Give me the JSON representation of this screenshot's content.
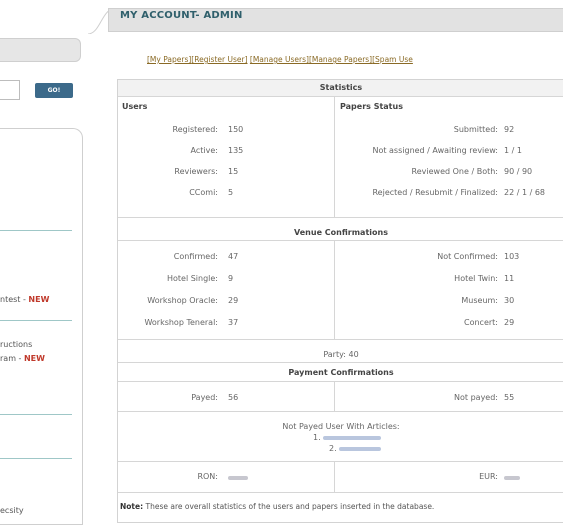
{
  "sidebar": {
    "go_label": "GO!",
    "links": [
      {
        "text": "ntest - ",
        "badge": "NEW"
      },
      {
        "text": "ructions",
        "badge": ""
      },
      {
        "text": "ram - ",
        "badge": "NEW"
      },
      {
        "text": "ecsity",
        "badge": ""
      }
    ]
  },
  "header": {
    "title": "MY ACCOUNT- ADMIN"
  },
  "nav": [
    "[My Papers]",
    "[Register User]",
    "[Manage Users]",
    "[Manage Papers]",
    "[Spam Use"
  ],
  "stats": {
    "title": "Statistics",
    "users": {
      "heading": "Users",
      "rows": [
        {
          "label": "Registered:",
          "value": "150"
        },
        {
          "label": "Active:",
          "value": "135"
        },
        {
          "label": "Reviewers:",
          "value": "15"
        },
        {
          "label": "CComi:",
          "value": "5"
        }
      ]
    },
    "papers": {
      "heading": "Papers Status",
      "rows": [
        {
          "label": "Submitted:",
          "value": "92"
        },
        {
          "label": "Not assigned / Awaiting review:",
          "value": "1 / 1"
        },
        {
          "label": "Reviewed One / Both:",
          "value": "90 / 90"
        },
        {
          "label": "Rejected / Resubmit / Finalized:",
          "value": "22 / 1 / 68"
        }
      ]
    },
    "venue": {
      "title": "Venue Confirmations",
      "left": [
        {
          "label": "Confirmed:",
          "value": "47"
        },
        {
          "label": "Hotel Single:",
          "value": "9"
        },
        {
          "label": "Workshop Oracle:",
          "value": "29"
        },
        {
          "label": "Workshop Teneral:",
          "value": "37"
        }
      ],
      "right": [
        {
          "label": "Not Confirmed:",
          "value": "103"
        },
        {
          "label": "Hotel Twin:",
          "value": "11"
        },
        {
          "label": "Museum:",
          "value": "30"
        },
        {
          "label": "Concert:",
          "value": "29"
        }
      ]
    },
    "party": "Party: 40",
    "payment": {
      "title": "Payment Confirmations",
      "payed_label": "Payed:",
      "payed_value": "56",
      "not_payed_label": "Not payed:",
      "not_payed_value": "55",
      "not_payed_users_title": "Not Payed User With Articles:",
      "list_nums": [
        "1.",
        "2."
      ],
      "ron_label": "RON:",
      "eur_label": "EUR:"
    },
    "note_bold": "Note:",
    "note_text": " These are overall statistics of the users and papers inserted in the database."
  }
}
